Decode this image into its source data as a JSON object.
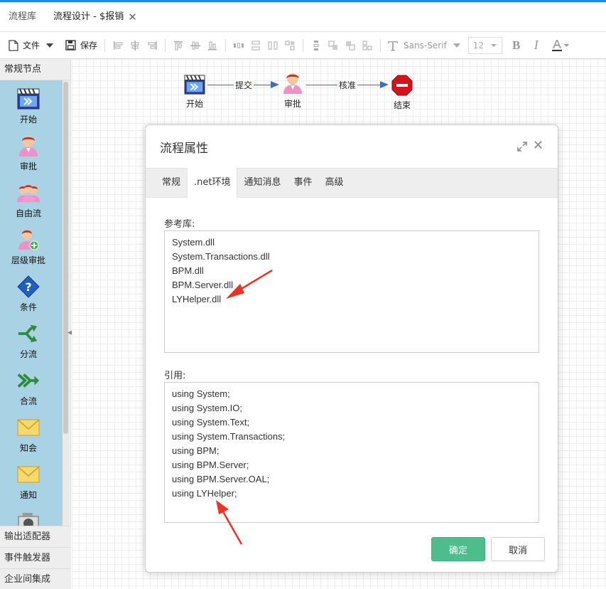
{
  "tabs": [
    {
      "label": "流程库"
    },
    {
      "label": "流程设计 - $报销",
      "close": "✕"
    }
  ],
  "toolbar": {
    "file_label": "文件",
    "save_label": "保存",
    "font_family": "Sans-Serif",
    "font_size": "12",
    "font_color": "#333333"
  },
  "sidebar": {
    "title": "常规节点",
    "items": [
      {
        "label": "开始",
        "icon": "film-start-icon"
      },
      {
        "label": "审批",
        "icon": "user-approve-icon"
      },
      {
        "label": "自由流",
        "icon": "users-group-icon"
      },
      {
        "label": "层级审批",
        "icon": "user-add-icon"
      },
      {
        "label": "条件",
        "icon": "question-diamond-icon"
      },
      {
        "label": "分流",
        "icon": "split-arrow-icon"
      },
      {
        "label": "合流",
        "icon": "merge-arrow-icon"
      },
      {
        "label": "知会",
        "icon": "mail-icon"
      },
      {
        "label": "通知",
        "icon": "mail-icon"
      }
    ],
    "sections": [
      "输出适配器",
      "事件触发器",
      "企业间集成"
    ]
  },
  "canvas": {
    "nodes": [
      {
        "label": "开始",
        "icon": "film-start-icon"
      },
      {
        "label": "审批",
        "icon": "user-approve-icon"
      },
      {
        "label": "结束",
        "icon": "stop-icon"
      }
    ],
    "links": [
      {
        "label": "提交"
      },
      {
        "label": "核准"
      }
    ]
  },
  "dialog": {
    "title": "流程属性",
    "tabs": [
      "常规",
      ".net环境",
      "通知消息",
      "事件",
      "高级"
    ],
    "active_tab": ".net环境",
    "references_label": "参考库:",
    "references": [
      "System.dll",
      "System.Transactions.dll",
      "BPM.dll",
      "BPM.Server.dll",
      "LYHelper.dll"
    ],
    "usings_label": "引用:",
    "usings": [
      "using System;",
      "using System.IO;",
      "using System.Text;",
      "using System.Transactions;",
      "using BPM;",
      "using BPM.Server;",
      "using BPM.Server.OAL;",
      "using LYHelper;"
    ],
    "ok_label": "确定",
    "cancel_label": "取消"
  },
  "colors": {
    "accent": "#1e88e5",
    "palette_bg": "#a9d3e4",
    "ok_button": "#4dbd8c",
    "link_line": "#3b6dc4",
    "annotation_arrow": "#ee3322"
  }
}
